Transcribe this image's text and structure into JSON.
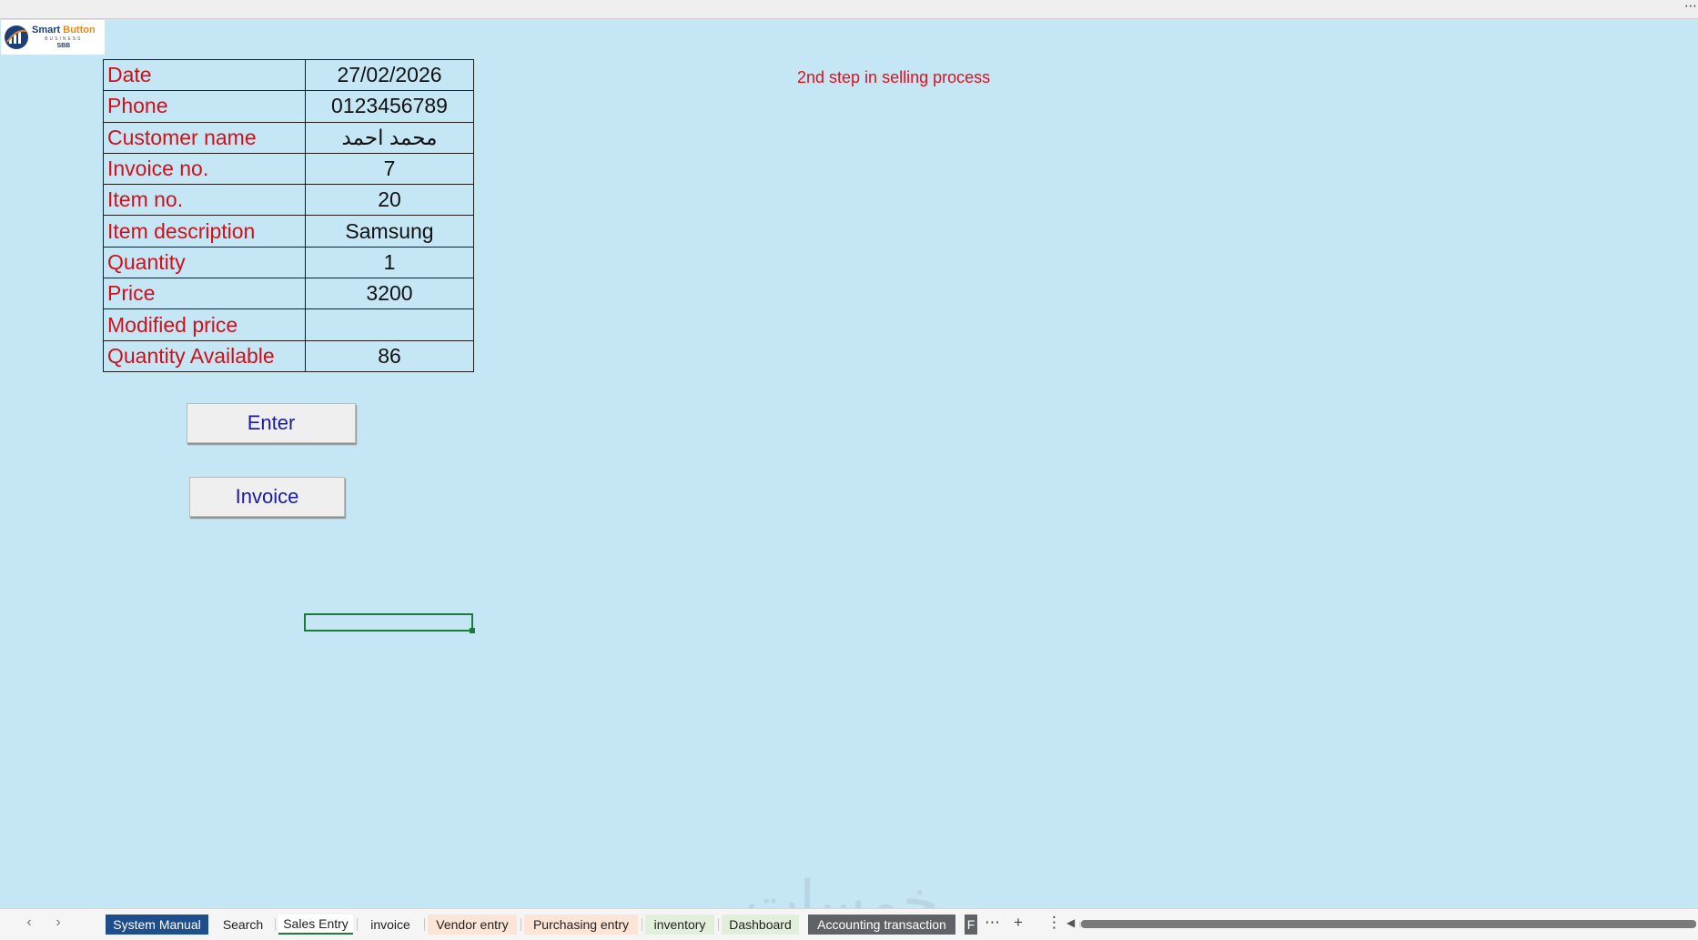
{
  "logo": {
    "line1_a": "Smart",
    "line1_b": "Button",
    "line2": "BUSINESS",
    "line3": "SBB"
  },
  "note": "2nd step in selling process",
  "form": {
    "rows": [
      {
        "label": "Date",
        "value": "27/02/2026"
      },
      {
        "label": "Phone",
        "value": "0123456789"
      },
      {
        "label": "Customer name",
        "value": "محمد احمد"
      },
      {
        "label": "Invoice no.",
        "value": "7"
      },
      {
        "label": "Item no.",
        "value": "20"
      },
      {
        "label": "Item description",
        "value": "Samsung"
      },
      {
        "label": "Quantity",
        "value": "1"
      },
      {
        "label": "Price",
        "value": "3200"
      },
      {
        "label": "Modified price",
        "value": ""
      },
      {
        "label": "Quantity Available",
        "value": "86"
      }
    ]
  },
  "buttons": {
    "enter": "Enter",
    "invoice": "Invoice"
  },
  "watermark": "خمسات",
  "sheet_tabs": [
    "System Manual",
    "Search",
    "Sales Entry",
    "invoice",
    "Vendor entry",
    "Purchasing entry",
    "inventory",
    "Dashboard",
    "Accounting transaction",
    "F"
  ],
  "toolbar": {
    "more": "⋯",
    "add": "+",
    "menu": "⋮",
    "top_more": "⋯"
  },
  "colors": {
    "background": "#c5e6f4",
    "label_red": "#d0101a",
    "button_text": "#1a1aa8"
  }
}
